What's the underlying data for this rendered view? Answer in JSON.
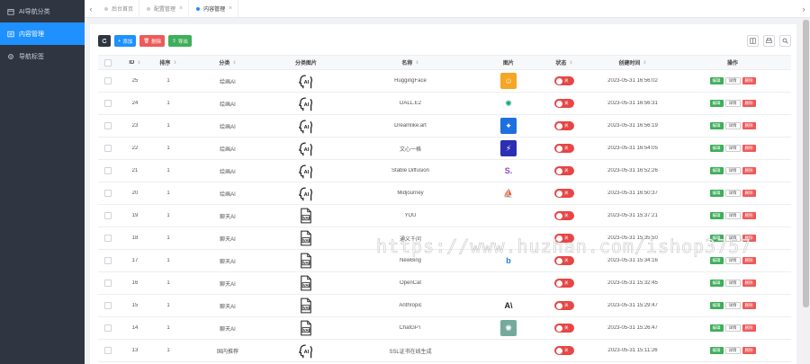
{
  "sidebar": {
    "items": [
      {
        "label": "AI导航分类",
        "icon": "calendar-icon",
        "active": false
      },
      {
        "label": "内容管理",
        "icon": "list-icon",
        "active": true
      },
      {
        "label": "导航标签",
        "icon": "gear-icon",
        "active": false
      }
    ]
  },
  "tabs": [
    {
      "label": "后台首页",
      "active": false,
      "closable": false
    },
    {
      "label": "配置管理",
      "active": false,
      "closable": true
    },
    {
      "label": "内容管理",
      "active": true,
      "closable": true
    }
  ],
  "toolbar": {
    "add_label": "添加",
    "delete_label": "删除",
    "export_label": "导出"
  },
  "table": {
    "headers": {
      "id": "ID",
      "sort": "排序",
      "category": "分类",
      "category_img": "分类图片",
      "name": "名称",
      "image": "图片",
      "status": "状态",
      "created": "创建时间",
      "ops": "操作"
    },
    "ops": {
      "edit": "编辑",
      "detail": "详情",
      "delete": "删除"
    },
    "status_label": "关",
    "rows": [
      {
        "id": "25",
        "sort": "1",
        "category": "绘画AI",
        "cat_icon": "ai-head",
        "name": "HuggingFace",
        "logo": {
          "icon": "huggingface-logo",
          "bg": "#f5a623",
          "glyph": "☺"
        },
        "created": "2023-05-31 16:56:02"
      },
      {
        "id": "24",
        "sort": "1",
        "category": "绘画AI",
        "cat_icon": "ai-head",
        "name": "DALL.E2",
        "logo": {
          "icon": "openai-logo",
          "bg": "#ffffff",
          "glyph": "✺",
          "color": "#10a37f"
        },
        "created": "2023-05-31 16:56:31"
      },
      {
        "id": "23",
        "sort": "1",
        "category": "绘画AI",
        "cat_icon": "ai-head",
        "name": "Dreamlike.art",
        "logo": {
          "icon": "dreamlike-logo",
          "bg": "#1e6fe0",
          "glyph": "✦"
        },
        "created": "2023-05-31 16:56:19"
      },
      {
        "id": "22",
        "sort": "1",
        "category": "绘画AI",
        "cat_icon": "ai-head",
        "name": "文心一格",
        "logo": {
          "icon": "wenxin-logo",
          "bg": "#2b2fb3",
          "glyph": "⚡"
        },
        "created": "2023-05-31 16:54:05"
      },
      {
        "id": "21",
        "sort": "1",
        "category": "绘画AI",
        "cat_icon": "ai-head",
        "name": "Stable Diffusion",
        "logo": {
          "icon": "stability-logo",
          "bg": "#ffffff",
          "glyph": "S.",
          "color": "#8b3dd9"
        },
        "created": "2023-05-31 16:52:26"
      },
      {
        "id": "20",
        "sort": "1",
        "category": "绘画AI",
        "cat_icon": "ai-head",
        "name": "Midjourney",
        "logo": {
          "icon": "midjourney-logo",
          "bg": "#ffffff",
          "glyph": "⛵",
          "color": "#333333"
        },
        "created": "2023-05-31 16:50:37"
      },
      {
        "id": "19",
        "sort": "1",
        "category": "聊天AI",
        "cat_icon": "ai-doc",
        "name": "YOU",
        "logo": null,
        "created": "2023-05-31 15:37:21"
      },
      {
        "id": "18",
        "sort": "1",
        "category": "聊天AI",
        "cat_icon": "ai-doc",
        "name": "通义千问",
        "logo": null,
        "created": "2023-05-31 15:35:50"
      },
      {
        "id": "17",
        "sort": "1",
        "category": "聊天AI",
        "cat_icon": "ai-doc",
        "name": "NewBing",
        "logo": {
          "icon": "bing-logo",
          "bg": "#ffffff",
          "glyph": "b",
          "color": "#1e7fd6"
        },
        "created": "2023-05-31 15:34:16"
      },
      {
        "id": "16",
        "sort": "1",
        "category": "聊天AI",
        "cat_icon": "ai-doc",
        "name": "OpenCat",
        "logo": null,
        "created": "2023-05-31 15:32:45"
      },
      {
        "id": "15",
        "sort": "1",
        "category": "聊天AI",
        "cat_icon": "ai-doc",
        "name": "Anthropic",
        "logo": {
          "icon": "anthropic-logo",
          "bg": "#ffffff",
          "glyph": "A\\",
          "color": "#222222"
        },
        "created": "2023-05-31 15:29:47"
      },
      {
        "id": "14",
        "sort": "1",
        "category": "聊天AI",
        "cat_icon": "ai-doc",
        "name": "ChatGPT",
        "logo": {
          "icon": "chatgpt-logo",
          "bg": "#74aa9c",
          "glyph": "✺"
        },
        "created": "2023-05-31 15:26:47"
      },
      {
        "id": "13",
        "sort": "1",
        "category": "国内推荐",
        "cat_icon": "ai-head",
        "name": "SSL证书在线生成",
        "logo": null,
        "created": "2023-05-31 15:11:26"
      }
    ]
  },
  "watermark": "https://www.huzhan.com/ishop3757",
  "colors": {
    "sidebar_bg": "#2f3541",
    "accent": "#1e90ff",
    "danger": "#ee5a5a",
    "success": "#3fae5a"
  }
}
